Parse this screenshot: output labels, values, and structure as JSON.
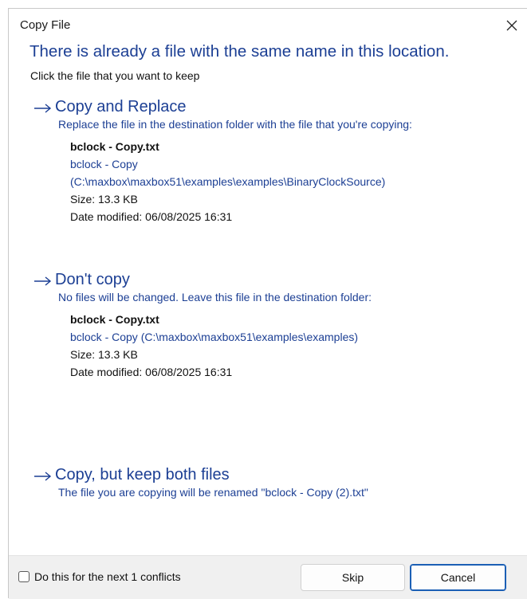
{
  "window": {
    "title": "Copy File",
    "close_icon": "close-icon"
  },
  "header": {
    "headline": "There is already a file with the same name in this location.",
    "subhead": "Click the file that you want to keep"
  },
  "options": {
    "replace": {
      "title": "Copy and Replace",
      "description": "Replace the file in the destination folder with the file that you're copying:",
      "file_name": "bclock - Copy.txt",
      "path_line1": "bclock - Copy",
      "path_line2": "(C:\\maxbox\\maxbox51\\examples\\examples\\BinaryClockSource)",
      "size": "Size: 13.3 KB",
      "date": "Date modified: 06/08/2025 16:31"
    },
    "dont_copy": {
      "title": "Don't copy",
      "description": "No files will be changed. Leave this file in the destination folder:",
      "file_name": "bclock - Copy.txt",
      "path_line1": "bclock - Copy (C:\\maxbox\\maxbox51\\examples\\examples)",
      "size": "Size: 13.3 KB",
      "date": "Date modified: 06/08/2025 16:31"
    },
    "keep_both": {
      "title": "Copy, but keep both files",
      "description": "The file you are copying will be renamed \"bclock - Copy (2).txt\""
    }
  },
  "footer": {
    "checkbox_label": "Do this for the next 1 conflicts",
    "checkbox_checked": false,
    "skip_label": "Skip",
    "cancel_label": "Cancel"
  },
  "colors": {
    "accent_text": "#1c3f94",
    "footer_bg": "#f0f0f0",
    "default_button_border": "#1b5fb5"
  }
}
